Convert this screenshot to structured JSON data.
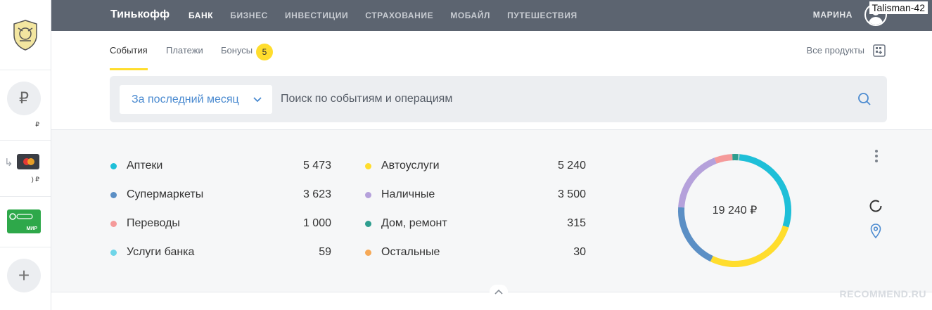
{
  "header": {
    "brand": "Тинькофф",
    "nav": [
      "БАНК",
      "БИЗНЕС",
      "ИНВЕСТИЦИИ",
      "СТРАХОВАНИЕ",
      "МОБАЙЛ",
      "ПУТЕШЕСТВИЯ"
    ],
    "active_nav": "БАНК",
    "user_name": "МАРИНА",
    "overlay_tag": "Talisman-42"
  },
  "sidebar": {
    "rub_symbol": "₽",
    "rub_caption": "₽",
    "card1_caption": ") ₽",
    "card2_label": "МИР",
    "add_symbol": "+"
  },
  "subtabs": {
    "events": "События",
    "payments": "Платежи",
    "bonuses": "Бонусы",
    "bonuses_count": "5",
    "all_products": "Все продукты"
  },
  "search": {
    "period": "За последний месяц",
    "placeholder": "Поиск по событиям и операциям"
  },
  "colors": {
    "pharmacy": "#1ebfd8",
    "auto": "#ffdd2d",
    "supermarkets": "#5b8fc5",
    "cash": "#b5a1db",
    "transfers": "#f59a9a",
    "home": "#2e9e8f",
    "bank": "#6fd5e8",
    "other": "#f6a957"
  },
  "categories": [
    {
      "label": "Аптеки",
      "value": "5 473",
      "color": "#1ebfd8"
    },
    {
      "label": "Супермаркеты",
      "value": "3 623",
      "color": "#5b8fc5"
    },
    {
      "label": "Переводы",
      "value": "1 000",
      "color": "#f59a9a"
    },
    {
      "label": "Услуги банка",
      "value": "59",
      "color": "#6fd5e8"
    },
    {
      "label": "Автоуслуги",
      "value": "5 240",
      "color": "#ffdd2d"
    },
    {
      "label": "Наличные",
      "value": "3 500",
      "color": "#b5a1db"
    },
    {
      "label": "Дом, ремонт",
      "value": "315",
      "color": "#2e9e8f"
    },
    {
      "label": "Остальные",
      "value": "30",
      "color": "#f6a957"
    }
  ],
  "total": "19 240 ₽",
  "chart_data": {
    "type": "pie",
    "title": "",
    "center_label": "19 240 ₽",
    "series": [
      {
        "name": "Аптеки",
        "value": 5473,
        "color": "#1ebfd8"
      },
      {
        "name": "Автоуслуги",
        "value": 5240,
        "color": "#ffdd2d"
      },
      {
        "name": "Супермаркеты",
        "value": 3623,
        "color": "#5b8fc5"
      },
      {
        "name": "Наличные",
        "value": 3500,
        "color": "#b5a1db"
      },
      {
        "name": "Переводы",
        "value": 1000,
        "color": "#f59a9a"
      },
      {
        "name": "Дом, ремонт",
        "value": 315,
        "color": "#2e9e8f"
      },
      {
        "name": "Услуги банка",
        "value": 59,
        "color": "#6fd5e8"
      },
      {
        "name": "Остальные",
        "value": 30,
        "color": "#f6a957"
      }
    ]
  },
  "footer": {
    "watermark": "RECOMMEND.RU"
  }
}
